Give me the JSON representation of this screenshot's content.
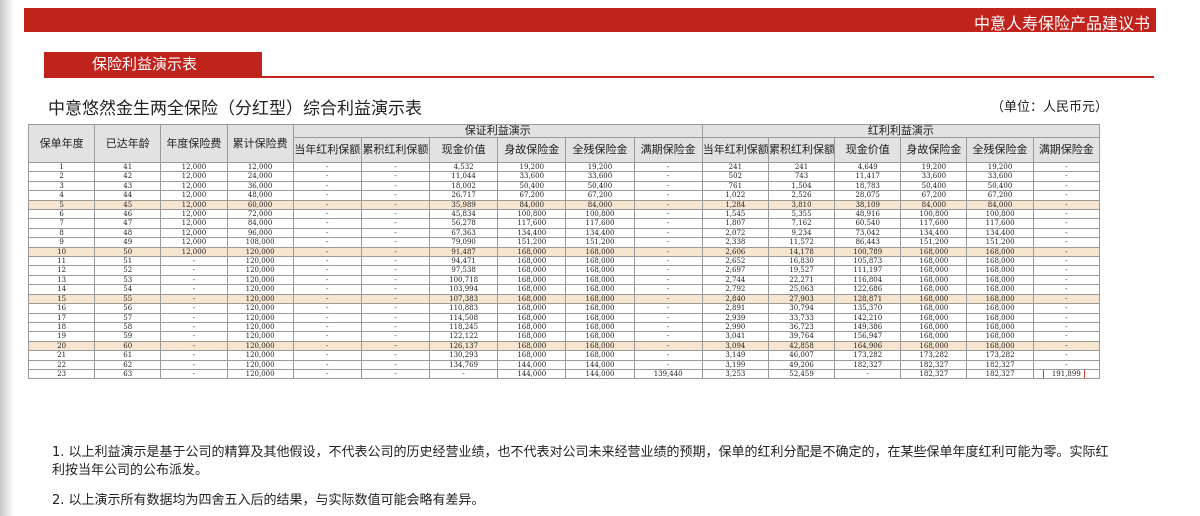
{
  "header": {
    "doc_type": "中意人寿保险产品建议书"
  },
  "section": {
    "title": "保险利益演示表"
  },
  "page": {
    "title": "中意悠然金生两全保险（分红型）综合利益演示表",
    "unit": "（单位：人民币元）"
  },
  "table": {
    "col_policy_year": "保单年度",
    "col_age": "已达年龄",
    "col_annual_premium": "年度保险费",
    "col_cum_premium": "累计保险费",
    "group_guaranteed": "保证利益演示",
    "group_dividend": "红利利益演示",
    "g_cols": [
      "当年红利保额",
      "累积红利保额",
      "现金价值",
      "身故保险金",
      "全残保险金",
      "满期保险金"
    ],
    "d_cols": [
      "当年红利保额",
      "累积红利保额",
      "现金价值",
      "身故保险金",
      "全残保险金",
      "满期保险金"
    ],
    "rows": [
      [
        "1",
        "41",
        "12,000",
        "12,000",
        "-",
        "-",
        "4,532",
        "19,200",
        "19,200",
        "-",
        "241",
        "241",
        "4,649",
        "19,200",
        "19,200",
        "-"
      ],
      [
        "2",
        "42",
        "12,000",
        "24,000",
        "-",
        "-",
        "11,044",
        "33,600",
        "33,600",
        "-",
        "502",
        "743",
        "11,417",
        "33,600",
        "33,600",
        "-"
      ],
      [
        "3",
        "43",
        "12,000",
        "36,000",
        "-",
        "-",
        "18,002",
        "50,400",
        "50,400",
        "-",
        "761",
        "1,504",
        "18,783",
        "50,400",
        "50,400",
        "-"
      ],
      [
        "4",
        "44",
        "12,000",
        "48,000",
        "-",
        "-",
        "26,717",
        "67,200",
        "67,200",
        "-",
        "1,022",
        "2,526",
        "28,075",
        "67,200",
        "67,200",
        "-"
      ],
      [
        "5",
        "45",
        "12,000",
        "60,000",
        "-",
        "-",
        "35,989",
        "84,000",
        "84,000",
        "-",
        "1,284",
        "3,810",
        "38,109",
        "84,000",
        "84,000",
        "-"
      ],
      [
        "6",
        "46",
        "12,000",
        "72,000",
        "-",
        "-",
        "45,834",
        "100,800",
        "100,800",
        "-",
        "1,545",
        "5,355",
        "48,916",
        "100,800",
        "100,800",
        "-"
      ],
      [
        "7",
        "47",
        "12,000",
        "84,000",
        "-",
        "-",
        "56,278",
        "117,600",
        "117,600",
        "-",
        "1,807",
        "7,162",
        "60,540",
        "117,600",
        "117,600",
        "-"
      ],
      [
        "8",
        "48",
        "12,000",
        "96,000",
        "-",
        "-",
        "67,363",
        "134,400",
        "134,400",
        "-",
        "2,072",
        "9,234",
        "73,042",
        "134,400",
        "134,400",
        "-"
      ],
      [
        "9",
        "49",
        "12,000",
        "108,000",
        "-",
        "-",
        "79,090",
        "151,200",
        "151,200",
        "-",
        "2,338",
        "11,572",
        "86,443",
        "151,200",
        "151,200",
        "-"
      ],
      [
        "10",
        "50",
        "12,000",
        "120,000",
        "-",
        "-",
        "91,487",
        "168,000",
        "168,000",
        "-",
        "2,606",
        "14,178",
        "100,789",
        "168,000",
        "168,000",
        "-"
      ],
      [
        "11",
        "51",
        "-",
        "120,000",
        "-",
        "-",
        "94,471",
        "168,000",
        "168,000",
        "-",
        "2,652",
        "16,830",
        "105,873",
        "168,000",
        "168,000",
        "-"
      ],
      [
        "12",
        "52",
        "-",
        "120,000",
        "-",
        "-",
        "97,538",
        "168,000",
        "168,000",
        "-",
        "2,697",
        "19,527",
        "111,197",
        "168,000",
        "168,000",
        "-"
      ],
      [
        "13",
        "53",
        "-",
        "120,000",
        "-",
        "-",
        "100,718",
        "168,000",
        "168,000",
        "-",
        "2,744",
        "22,271",
        "116,804",
        "168,000",
        "168,000",
        "-"
      ],
      [
        "14",
        "54",
        "-",
        "120,000",
        "-",
        "-",
        "103,994",
        "168,000",
        "168,000",
        "-",
        "2,792",
        "25,063",
        "122,686",
        "168,000",
        "168,000",
        "-"
      ],
      [
        "15",
        "55",
        "-",
        "120,000",
        "-",
        "-",
        "107,383",
        "168,000",
        "168,000",
        "-",
        "2,840",
        "27,903",
        "128,871",
        "168,000",
        "168,000",
        "-"
      ],
      [
        "16",
        "56",
        "-",
        "120,000",
        "-",
        "-",
        "110,883",
        "168,000",
        "168,000",
        "-",
        "2,891",
        "30,794",
        "135,370",
        "168,000",
        "168,000",
        "-"
      ],
      [
        "17",
        "57",
        "-",
        "120,000",
        "-",
        "-",
        "114,508",
        "168,000",
        "168,000",
        "-",
        "2,939",
        "33,733",
        "142,210",
        "168,000",
        "168,000",
        "-"
      ],
      [
        "18",
        "58",
        "-",
        "120,000",
        "-",
        "-",
        "118,245",
        "168,000",
        "168,000",
        "-",
        "2,990",
        "36,723",
        "149,386",
        "168,000",
        "168,000",
        "-"
      ],
      [
        "19",
        "59",
        "-",
        "120,000",
        "-",
        "-",
        "122,122",
        "168,000",
        "168,000",
        "-",
        "3,041",
        "39,764",
        "156,947",
        "168,000",
        "168,000",
        "-"
      ],
      [
        "20",
        "60",
        "-",
        "120,000",
        "-",
        "-",
        "126,137",
        "168,000",
        "168,000",
        "-",
        "3,094",
        "42,858",
        "164,906",
        "168,000",
        "168,000",
        "-"
      ],
      [
        "21",
        "61",
        "-",
        "120,000",
        "-",
        "-",
        "130,293",
        "168,000",
        "168,000",
        "-",
        "3,149",
        "46,007",
        "173,282",
        "173,282",
        "173,282",
        "-"
      ],
      [
        "22",
        "62",
        "-",
        "120,000",
        "-",
        "-",
        "134,769",
        "144,000",
        "144,000",
        "-",
        "3,199",
        "49,206",
        "182,327",
        "182,327",
        "182,327",
        "-"
      ],
      [
        "23",
        "63",
        "-",
        "120,000",
        "-",
        "-",
        "-",
        "144,000",
        "144,000",
        "139,440",
        "3,253",
        "52,459",
        "-",
        "182,327",
        "182,327",
        "191,899"
      ]
    ],
    "shaded_rows": [
      5,
      10,
      15,
      20
    ],
    "highlight_color": "#e0352b",
    "shade_color": "#f6e5cf"
  },
  "notes": [
    "1. 以上利益演示是基于公司的精算及其他假设，不代表公司的历史经营业绩，也不代表对公司未来经营业绩的预期，保单的红利分配是不确定的，在某些保单年度红利可能为零。实际红利按当年公司的公布派发。",
    "2. 以上演示所有数据均为四舍五入后的结果，与实际数值可能会略有差异。"
  ],
  "colors": {
    "brand_red": "#c0221c"
  }
}
